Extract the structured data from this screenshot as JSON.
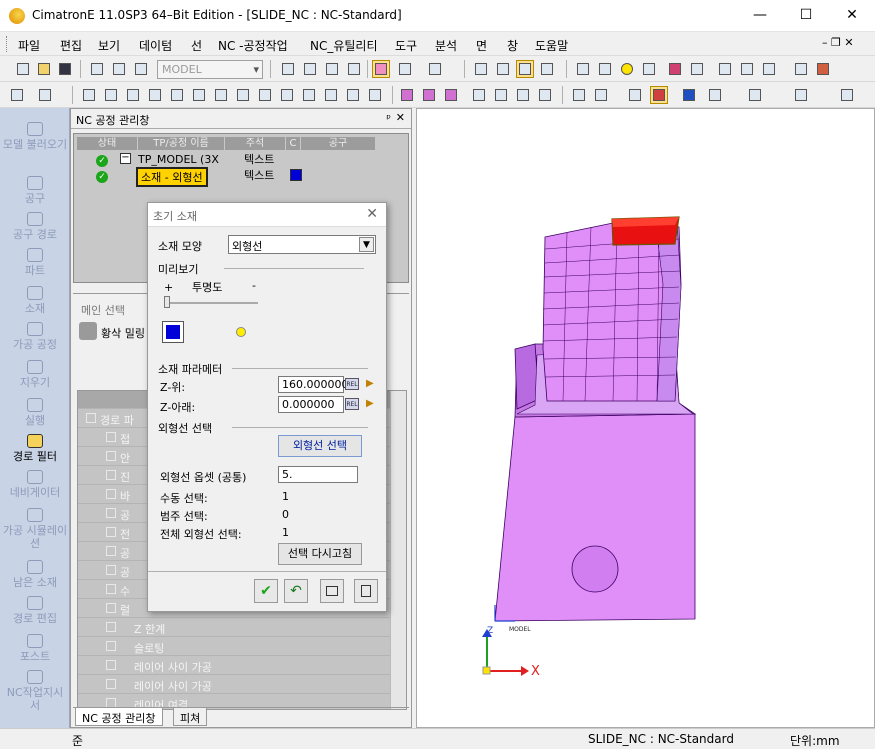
{
  "window": {
    "title": "CimatronE 11.0SP3 64–Bit Edition - [SLIDE_NC : NC-Standard]",
    "minimize": "—",
    "maximize": "☐",
    "close": "✕"
  },
  "menu": {
    "items": [
      "파일",
      "편집",
      "보기",
      "데이텀",
      "선",
      "NC -공정작업",
      "NC_유틸리티",
      "도구",
      "분석",
      "면",
      "창",
      "도움말"
    ],
    "mdi_controls": "– ❐ ✕"
  },
  "toolbar": {
    "model_combo": "MODEL"
  },
  "left_nav": {
    "items": [
      {
        "label": "모델 불러오기",
        "icon": "model-import-icon"
      },
      {
        "label": "공구",
        "icon": "tool-icon"
      },
      {
        "label": "공구 경로",
        "icon": "toolpath-icon"
      },
      {
        "label": "파트",
        "icon": "part-icon"
      },
      {
        "label": "소재",
        "icon": "stock-icon"
      },
      {
        "label": "가공 공정",
        "icon": "procedure-icon"
      },
      {
        "label": "지우기",
        "icon": "delete-icon"
      },
      {
        "label": "실행",
        "icon": "execute-icon"
      },
      {
        "label": "경로 필터",
        "icon": "path-filter-icon"
      },
      {
        "label": "네비게이터",
        "icon": "navigator-icon"
      },
      {
        "label": "가공 시뮬레이션",
        "icon": "simulation-icon"
      },
      {
        "label": "남은 소재",
        "icon": "remaining-stock-icon"
      },
      {
        "label": "경로 편집",
        "icon": "path-edit-icon"
      },
      {
        "label": "포스트",
        "icon": "post-icon"
      },
      {
        "label": "NC작업지시서",
        "icon": "nc-setup-sheet-icon"
      }
    ]
  },
  "nc_panel": {
    "title": "NC 공정 관리창",
    "pin": "ᵖ",
    "close": "✕",
    "columns": [
      "상태",
      "TP/공정 이름",
      "주석",
      "C",
      "공구"
    ],
    "rows": [
      {
        "name": "TP_MODEL (3X",
        "comment": "텍스트",
        "expander": "−"
      },
      {
        "name": "소재 - 외형선",
        "comment": "텍스트"
      }
    ],
    "main_select_label": "메인 선택",
    "main_select_button": "황삭 밀링",
    "tree_items": [
      "경로 파",
      "접",
      "안",
      "진",
      "바",
      "공",
      "전",
      "공",
      "공",
      "수",
      "럴",
      "Z 한계",
      "슬로팅",
      "레이어 사이 가공",
      "레이어 사이 가공",
      "레이어 여결"
    ],
    "tabs": [
      "NC 공정 관리창",
      "피쳐"
    ]
  },
  "dialog": {
    "title": "초기 소재",
    "close": "✕",
    "stock_shape_label": "소재 모양",
    "stock_shape_value": "외형선",
    "preview_label": "미리보기",
    "transparency_label": "투명도",
    "plus": "+",
    "minus": "-",
    "params_label": "소재 파라메터",
    "z_top_label": "Z-위:",
    "z_top_value": "160.000000",
    "z_bottom_label": "Z-아래:",
    "z_bottom_value": "0.000000",
    "rel": "REL",
    "contour_section_label": "외형선 선택",
    "contour_select_button": "외형선 선택",
    "offset_label": "외형선 옵셋 (공통)",
    "offset_value": "5.",
    "manual_label": "수동 선택:",
    "manual_value": "1",
    "category_label": "범주 선택:",
    "category_value": "0",
    "total_label": "전체 외형선 선택:",
    "total_value": "1",
    "reselect_button": "선택 다시고침",
    "ok_icon": "✔",
    "apply_icon": "↶"
  },
  "viewport": {
    "axis_x": "X",
    "axis_z": "Z",
    "model_tag": "MODEL",
    "colors": {
      "part": "#e08ef8",
      "part_shade": "#b86ae0",
      "stock_top": "#e81010",
      "edge": "#3a0060"
    }
  },
  "status": {
    "left": "준",
    "doc": "SLIDE_NC : NC-Standard",
    "units": "단위:mm"
  }
}
